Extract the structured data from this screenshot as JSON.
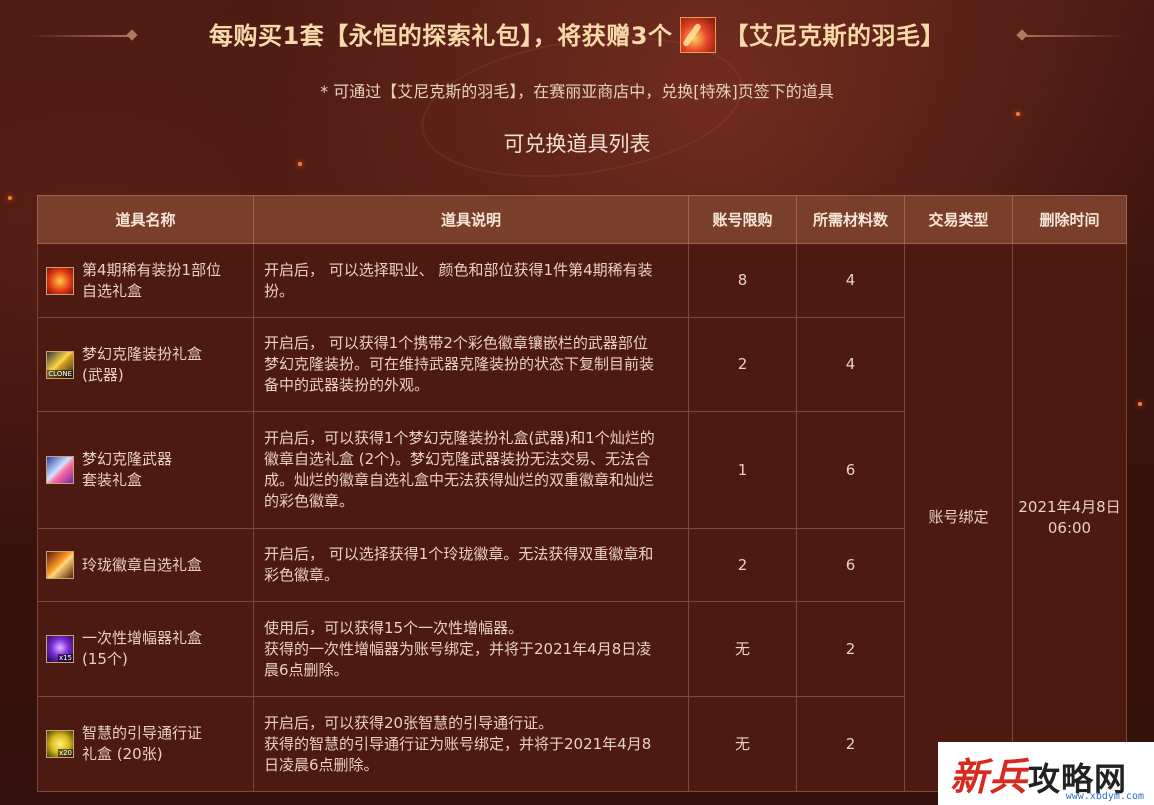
{
  "header": {
    "title_part1": "每购买1套【永恒的探索礼包】，将获赠3个",
    "feather_icon": "feather-icon",
    "title_part2": "【艾尼克斯的羽毛】",
    "subtitle": "* 可通过【艾尼克斯的羽毛】，在赛丽亚商店中，兑换[特殊]页签下的道具",
    "list_title": "可兑换道具列表"
  },
  "table": {
    "headers": {
      "name": "道具名称",
      "desc": "道具说明",
      "limit": "账号限购",
      "materials": "所需材料数",
      "trade": "交易类型",
      "delete": "删除时间"
    },
    "trade_type": "账号绑定",
    "delete_time_line1": "2021年4月8日",
    "delete_time_line2": "06:00",
    "rows": [
      {
        "icon": "costume-box-icon",
        "name_line1": "第4期稀有装扮1部位",
        "name_line2": "自选礼盒",
        "desc_line1": "开启后， 可以选择职业、 颜色和部位获得1件第4期稀有装",
        "desc_line2": "扮。",
        "limit": "8",
        "materials": "4"
      },
      {
        "icon": "weapon-clone-icon",
        "icon_tag": "CLONE",
        "name_line1": "梦幻克隆装扮礼盒",
        "name_line2": "(武器)",
        "desc_line1": "开启后， 可以获得1个携带2个彩色徽章镶嵌栏的武器部位",
        "desc_line2": "梦幻克隆装扮。可在维持武器克隆装扮的状态下复制目前装",
        "desc_line3": "备中的武器装扮的外观。",
        "limit": "2",
        "materials": "4"
      },
      {
        "icon": "clone-weapon-set-icon",
        "name_line1": "梦幻克隆武器",
        "name_line2": "套装礼盒",
        "desc_line1": "开启后，可以获得1个梦幻克隆装扮礼盒(武器)和1个灿烂的",
        "desc_line2": "徽章自选礼盒 (2个)。梦幻克隆武器装扮无法交易、无法合",
        "desc_line3": "成。灿烂的徽章自选礼盒中无法获得灿烂的双重徽章和灿烂",
        "desc_line4": "的彩色徽章。",
        "limit": "1",
        "materials": "6"
      },
      {
        "icon": "emblem-box-icon",
        "name_line1": "玲珑徽章自选礼盒",
        "desc_line1": "开启后， 可以选择获得1个玲珑徽章。无法获得双重徽章和",
        "desc_line2": "彩色徽章。",
        "limit": "2",
        "materials": "6"
      },
      {
        "icon": "amplifier-icon",
        "icon_tag": "x15",
        "name_line1": "一次性增幅器礼盒",
        "name_line2": "(15个)",
        "desc_line1": "使用后，可以获得15个一次性增幅器。",
        "desc_line2": "获得的一次性增幅器为账号绑定，并将于2021年4月8日凌",
        "desc_line3": "晨6点删除。",
        "limit": "无",
        "materials": "2"
      },
      {
        "icon": "guide-ticket-icon",
        "icon_tag": "x20",
        "name_line1": "智慧的引导通行证",
        "name_line2": "礼盒 (20张)",
        "desc_line1": "开启后，可以获得20张智慧的引导通行证。",
        "desc_line2": "获得的智慧的引导通行证为账号绑定，并将于2021年4月8",
        "desc_line3": "日凌晨6点删除。",
        "limit": "无",
        "materials": "2"
      }
    ]
  },
  "watermark": {
    "text_first": "新兵",
    "text_rest": "攻略网",
    "url": "www.xbdym.com"
  },
  "colors": {
    "background": "#3b140e",
    "header_text": "#f5d9a8",
    "table_header_bg": "#7a3e2c",
    "table_cell_bg": "#4d1a12",
    "watermark_red": "#d62a1e"
  }
}
